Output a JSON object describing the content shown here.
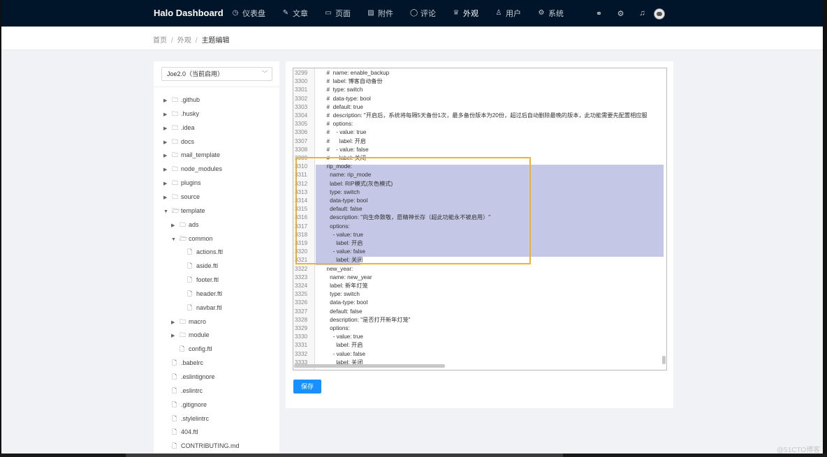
{
  "header": {
    "brand": "Halo  Dashboard",
    "nav": [
      {
        "icon": "dashboard-icon",
        "glyph": "◷",
        "label": "仪表盘"
      },
      {
        "icon": "edit-icon",
        "glyph": "✎",
        "label": "文章"
      },
      {
        "icon": "book-icon",
        "glyph": "▭",
        "label": "页面"
      },
      {
        "icon": "picture-icon",
        "glyph": "▨",
        "label": "附件"
      },
      {
        "icon": "comment-icon",
        "glyph": "◯",
        "label": "评论"
      },
      {
        "icon": "skin-icon",
        "glyph": "♕",
        "label": "外观"
      },
      {
        "icon": "user-icon",
        "glyph": "♙",
        "label": "用户"
      },
      {
        "icon": "setting-icon",
        "glyph": "⚙",
        "label": "系统"
      }
    ],
    "active_nav": "外观",
    "right_icons": [
      {
        "icon": "link-icon",
        "glyph": "⚭"
      },
      {
        "icon": "gear-icon",
        "glyph": "⚙"
      },
      {
        "icon": "bell-icon",
        "glyph": "♫"
      }
    ]
  },
  "breadcrumb": {
    "items": [
      "首页",
      "外观",
      "主题编辑"
    ]
  },
  "sidebar": {
    "theme_select": "Joe2.0（当前启用）",
    "tree": [
      {
        "label": ".github",
        "type": "folder",
        "depth": 0,
        "expanded": false
      },
      {
        "label": ".husky",
        "type": "folder",
        "depth": 0,
        "expanded": false
      },
      {
        "label": ".idea",
        "type": "folder",
        "depth": 0,
        "expanded": false
      },
      {
        "label": "docs",
        "type": "folder",
        "depth": 0,
        "expanded": false
      },
      {
        "label": "mail_template",
        "type": "folder",
        "depth": 0,
        "expanded": false
      },
      {
        "label": "node_modules",
        "type": "folder",
        "depth": 0,
        "expanded": false
      },
      {
        "label": "plugins",
        "type": "folder",
        "depth": 0,
        "expanded": false
      },
      {
        "label": "source",
        "type": "folder",
        "depth": 0,
        "expanded": false
      },
      {
        "label": "template",
        "type": "folder",
        "depth": 0,
        "expanded": true
      },
      {
        "label": "ads",
        "type": "folder",
        "depth": 1,
        "expanded": false
      },
      {
        "label": "common",
        "type": "folder",
        "depth": 1,
        "expanded": true
      },
      {
        "label": "actions.ftl",
        "type": "file",
        "depth": 2
      },
      {
        "label": "aside.ftl",
        "type": "file",
        "depth": 2
      },
      {
        "label": "footer.ftl",
        "type": "file",
        "depth": 2
      },
      {
        "label": "header.ftl",
        "type": "file",
        "depth": 2
      },
      {
        "label": "navbar.ftl",
        "type": "file",
        "depth": 2
      },
      {
        "label": "macro",
        "type": "folder",
        "depth": 1,
        "expanded": false
      },
      {
        "label": "module",
        "type": "folder",
        "depth": 1,
        "expanded": false
      },
      {
        "label": "config.ftl",
        "type": "file",
        "depth": 1
      },
      {
        "label": ".babelrc",
        "type": "file",
        "depth": 0
      },
      {
        "label": ".eslintignore",
        "type": "file",
        "depth": 0
      },
      {
        "label": ".eslintrc",
        "type": "file",
        "depth": 0
      },
      {
        "label": ".gitignore",
        "type": "file",
        "depth": 0
      },
      {
        "label": ".stylelintrc",
        "type": "file",
        "depth": 0
      },
      {
        "label": "404.ftl",
        "type": "file",
        "depth": 0
      },
      {
        "label": "CONTRIBUTING.md",
        "type": "file",
        "depth": 0
      }
    ]
  },
  "editor": {
    "lines": [
      {
        "n": "3299",
        "text": "  #  name: enable_backup"
      },
      {
        "n": "3300",
        "text": "  #  label: 博客自动备份"
      },
      {
        "n": "3301",
        "text": "  #  type: switch"
      },
      {
        "n": "3302",
        "text": "  #  data-type: bool"
      },
      {
        "n": "3303",
        "text": "  #  default: true"
      },
      {
        "n": "3304",
        "text": "  #  description: \"开启后，系统将每隔5天备份1次，最多备份版本为20份，超过后自动删除最晚的版本，此功能需要先配置相应服"
      },
      {
        "n": "3305",
        "text": "  #  options:"
      },
      {
        "n": "3306",
        "text": "  #    - value: true"
      },
      {
        "n": "3307",
        "text": "  #      label: 开启"
      },
      {
        "n": "3308",
        "text": "  #    - value: false"
      },
      {
        "n": "3309",
        "text": "  #      label: 关闭"
      },
      {
        "n": "3310",
        "text": "  rip_mode:"
      },
      {
        "n": "3311",
        "text": "    name: rip_mode"
      },
      {
        "n": "3312",
        "text": "    label: RIP模式(灰色模式)"
      },
      {
        "n": "3313",
        "text": "    type: switch"
      },
      {
        "n": "3314",
        "text": "    data-type: bool"
      },
      {
        "n": "3315",
        "text": "    default: false"
      },
      {
        "n": "3316",
        "text": "    description: \"向生命致敬，愿精神长存（超此功能永不被启用）\""
      },
      {
        "n": "3317",
        "text": "    options:"
      },
      {
        "n": "3318",
        "text": "      - value: true"
      },
      {
        "n": "3319",
        "text": "        label: 开启"
      },
      {
        "n": "3320",
        "text": "      - value: false"
      },
      {
        "n": "3321",
        "text": "        label: 关闭"
      },
      {
        "n": "3322",
        "text": "  new_year:"
      },
      {
        "n": "3323",
        "text": "    name: new_year"
      },
      {
        "n": "3324",
        "text": "    label: 新年灯笼"
      },
      {
        "n": "3325",
        "text": "    type: switch"
      },
      {
        "n": "3326",
        "text": "    data-type: bool"
      },
      {
        "n": "3327",
        "text": "    default: false"
      },
      {
        "n": "3328",
        "text": "    description: \"是否打开新年灯笼\""
      },
      {
        "n": "3329",
        "text": "    options:"
      },
      {
        "n": "3330",
        "text": "      - value: true"
      },
      {
        "n": "3331",
        "text": "        label: 开启"
      },
      {
        "n": "3332",
        "text": "      - value: false"
      },
      {
        "n": "3333",
        "text": "        label: 关闭"
      }
    ],
    "selection_color": "#c4c7e6",
    "highlight_box_color": "#f0b429"
  },
  "actions": {
    "save_label": "保存"
  },
  "watermark": "@51CTO博客",
  "colors": {
    "header_bg": "#001529",
    "primary": "#1890ff",
    "page_bg": "#f0f2f5"
  }
}
